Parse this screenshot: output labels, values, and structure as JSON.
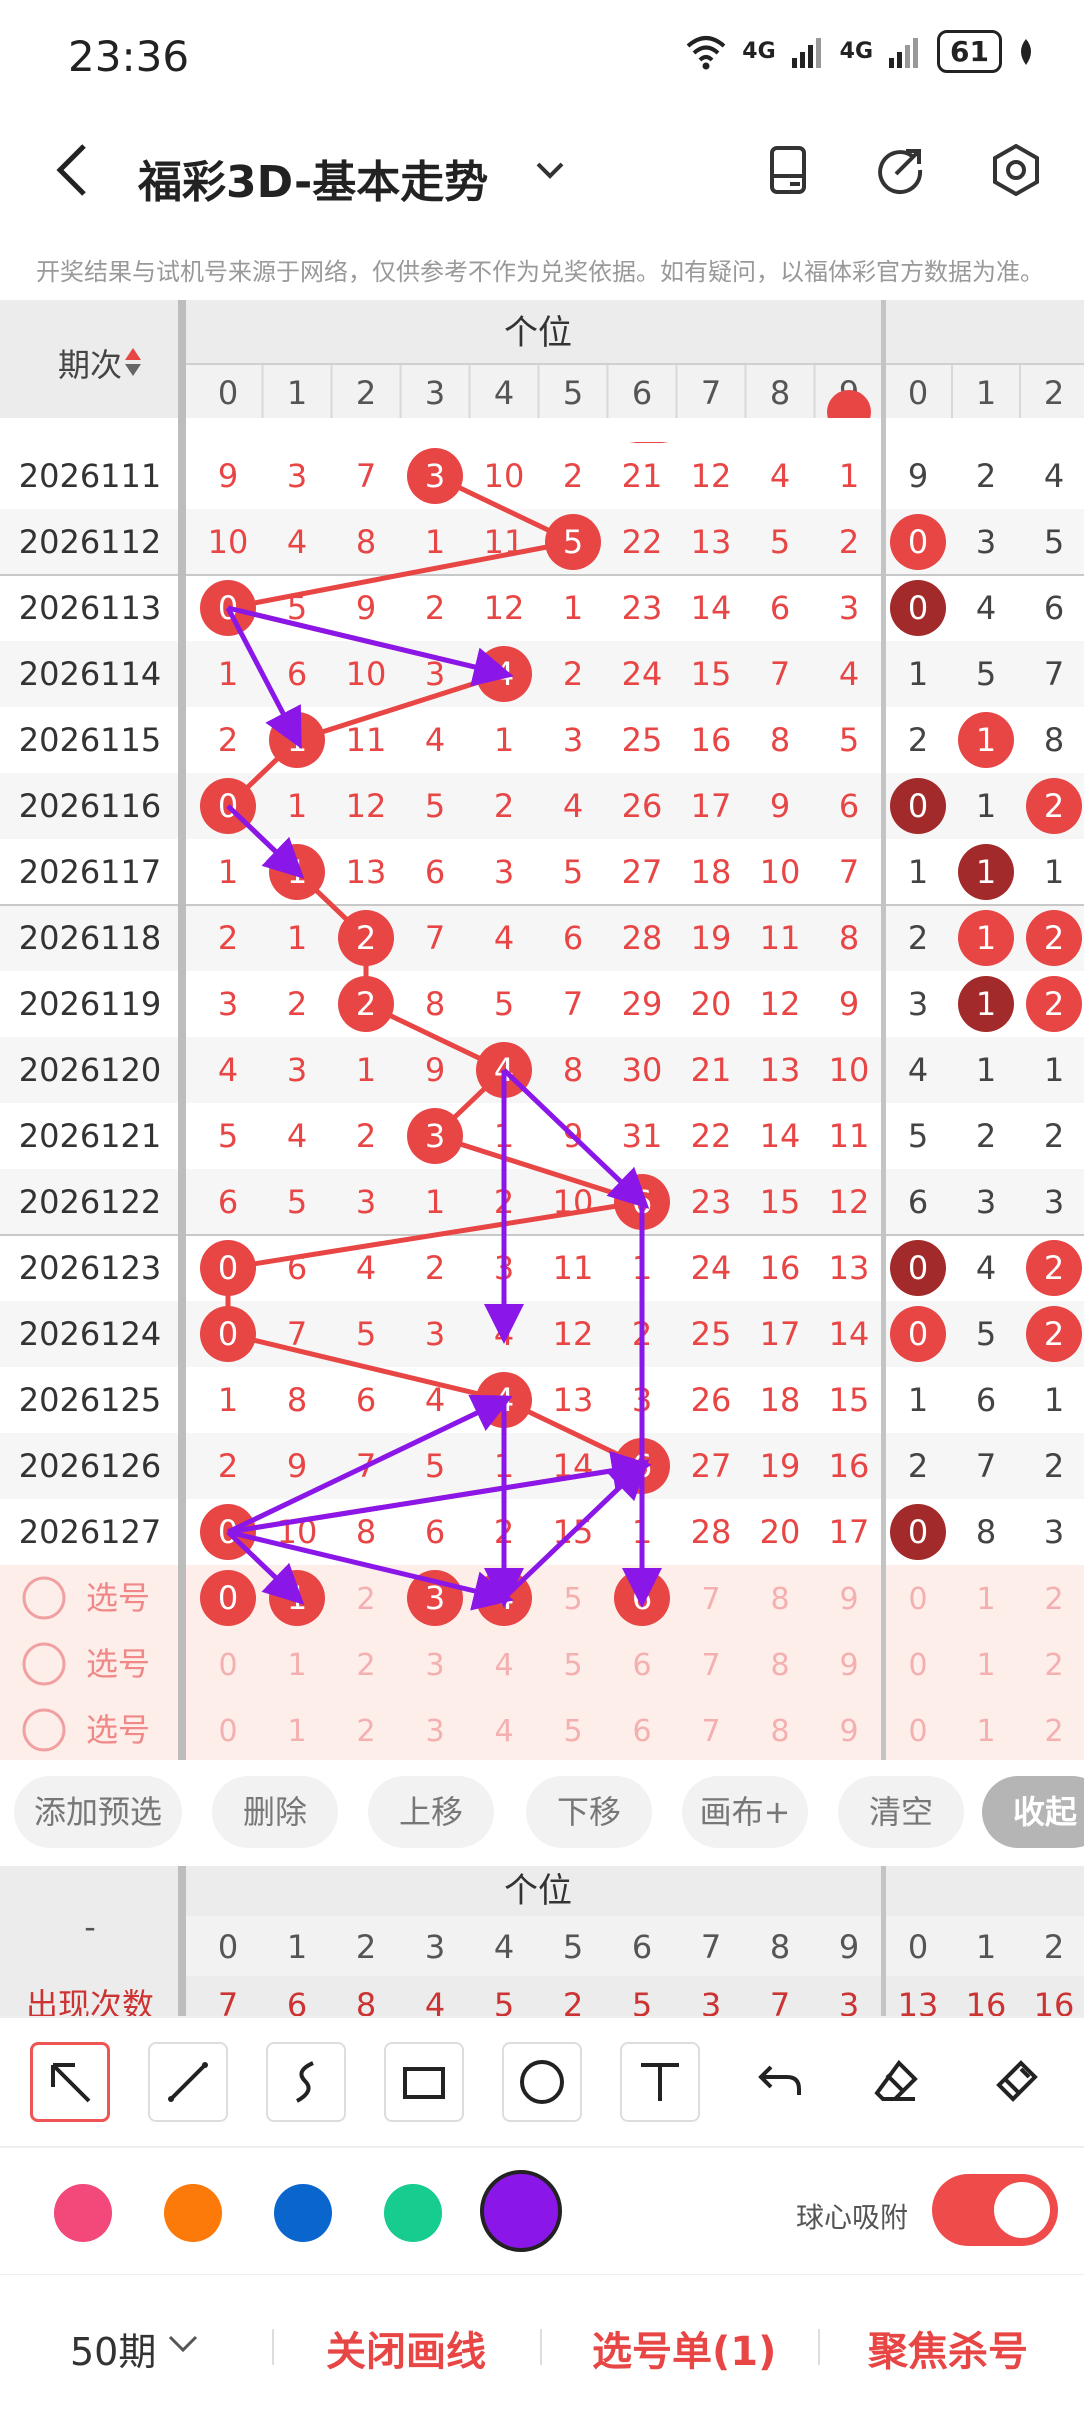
{
  "status": {
    "time": "23:36",
    "net1": "4G",
    "net2": "4G",
    "battery": "61"
  },
  "header": {
    "title": "福彩3D-基本走势"
  },
  "notice": "开奖结果与试机号来源于网络，仅供参考不作为兑奖依据。如有疑问，以福体彩官方数据为准。",
  "table": {
    "period_header": "期次",
    "group_label": "个位",
    "digits_main": [
      "0",
      "1",
      "2",
      "3",
      "4",
      "5",
      "6",
      "7",
      "8",
      "9"
    ],
    "digits_side": [
      "0",
      "1",
      "2"
    ],
    "rows": [
      {
        "period": "2026111",
        "main": [
          "9",
          "3",
          "7",
          "3",
          "10",
          "2",
          "21",
          "12",
          "4",
          "1"
        ],
        "hit": 3,
        "side": [
          "9",
          "2",
          "4"
        ],
        "side_hits": []
      },
      {
        "period": "2026112",
        "main": [
          "10",
          "4",
          "8",
          "1",
          "11",
          "5",
          "22",
          "13",
          "5",
          "2"
        ],
        "hit": 5,
        "side": [
          "0",
          "3",
          "5"
        ],
        "side_hits": [
          {
            "i": 0,
            "dark": false
          }
        ]
      },
      {
        "period": "2026113",
        "main": [
          "0",
          "5",
          "9",
          "2",
          "12",
          "1",
          "23",
          "14",
          "6",
          "3"
        ],
        "hit": 0,
        "side": [
          "0",
          "4",
          "6"
        ],
        "side_hits": [
          {
            "i": 0,
            "dark": true
          }
        ]
      },
      {
        "period": "2026114",
        "main": [
          "1",
          "6",
          "10",
          "3",
          "4",
          "2",
          "24",
          "15",
          "7",
          "4"
        ],
        "hit": 4,
        "side": [
          "1",
          "5",
          "7"
        ],
        "side_hits": []
      },
      {
        "period": "2026115",
        "main": [
          "2",
          "1",
          "11",
          "4",
          "1",
          "3",
          "25",
          "16",
          "8",
          "5"
        ],
        "hit": 1,
        "side": [
          "2",
          "1",
          "8"
        ],
        "side_hits": [
          {
            "i": 1,
            "dark": false
          }
        ]
      },
      {
        "period": "2026116",
        "main": [
          "0",
          "1",
          "12",
          "5",
          "2",
          "4",
          "26",
          "17",
          "9",
          "6"
        ],
        "hit": 0,
        "side": [
          "0",
          "1",
          "2"
        ],
        "side_hits": [
          {
            "i": 0,
            "dark": true
          },
          {
            "i": 2,
            "dark": false
          }
        ]
      },
      {
        "period": "2026117",
        "main": [
          "1",
          "1",
          "13",
          "6",
          "3",
          "5",
          "27",
          "18",
          "10",
          "7"
        ],
        "hit": 1,
        "side": [
          "1",
          "1",
          "1"
        ],
        "side_hits": [
          {
            "i": 1,
            "dark": true
          }
        ]
      },
      {
        "period": "2026118",
        "main": [
          "2",
          "1",
          "2",
          "7",
          "4",
          "6",
          "28",
          "19",
          "11",
          "8"
        ],
        "hit": 2,
        "side": [
          "2",
          "1",
          "2"
        ],
        "side_hits": [
          {
            "i": 1,
            "dark": false
          },
          {
            "i": 2,
            "dark": false
          }
        ]
      },
      {
        "period": "2026119",
        "main": [
          "3",
          "2",
          "2",
          "8",
          "5",
          "7",
          "29",
          "20",
          "12",
          "9"
        ],
        "hit": 2,
        "side": [
          "3",
          "1",
          "2"
        ],
        "side_hits": [
          {
            "i": 1,
            "dark": true
          },
          {
            "i": 2,
            "dark": false
          }
        ]
      },
      {
        "period": "2026120",
        "main": [
          "4",
          "3",
          "1",
          "9",
          "4",
          "8",
          "30",
          "21",
          "13",
          "10"
        ],
        "hit": 4,
        "side": [
          "4",
          "1",
          "1"
        ],
        "side_hits": []
      },
      {
        "period": "2026121",
        "main": [
          "5",
          "4",
          "2",
          "3",
          "1",
          "9",
          "31",
          "22",
          "14",
          "11"
        ],
        "hit": 3,
        "side": [
          "5",
          "2",
          "2"
        ],
        "side_hits": []
      },
      {
        "period": "2026122",
        "main": [
          "6",
          "5",
          "3",
          "1",
          "2",
          "10",
          "6",
          "23",
          "15",
          "12"
        ],
        "hit": 6,
        "side": [
          "6",
          "3",
          "3"
        ],
        "side_hits": []
      },
      {
        "period": "2026123",
        "main": [
          "0",
          "6",
          "4",
          "2",
          "3",
          "11",
          "1",
          "24",
          "16",
          "13"
        ],
        "hit": 0,
        "side": [
          "0",
          "4",
          "2"
        ],
        "side_hits": [
          {
            "i": 0,
            "dark": true
          },
          {
            "i": 2,
            "dark": false
          }
        ]
      },
      {
        "period": "2026124",
        "main": [
          "0",
          "7",
          "5",
          "3",
          "4",
          "12",
          "2",
          "25",
          "17",
          "14"
        ],
        "hit": 0,
        "side": [
          "0",
          "5",
          "2"
        ],
        "side_hits": [
          {
            "i": 0,
            "dark": false
          },
          {
            "i": 2,
            "dark": false
          }
        ]
      },
      {
        "period": "2026125",
        "main": [
          "1",
          "8",
          "6",
          "4",
          "4",
          "13",
          "3",
          "26",
          "18",
          "15"
        ],
        "hit": 4,
        "side": [
          "1",
          "6",
          "1"
        ],
        "side_hits": []
      },
      {
        "period": "2026126",
        "main": [
          "2",
          "9",
          "7",
          "5",
          "1",
          "14",
          "6",
          "27",
          "19",
          "16"
        ],
        "hit": 6,
        "side": [
          "2",
          "7",
          "2"
        ],
        "side_hits": []
      },
      {
        "period": "2026127",
        "main": [
          "0",
          "10",
          "8",
          "6",
          "2",
          "15",
          "1",
          "28",
          "20",
          "17"
        ],
        "hit": 0,
        "side": [
          "0",
          "8",
          "3"
        ],
        "side_hits": [
          {
            "i": 0,
            "dark": true
          }
        ]
      }
    ],
    "select_label": "选号",
    "select_rows": [
      {
        "hits": [
          0,
          1,
          3,
          4,
          6
        ]
      },
      {
        "hits": []
      },
      {
        "hits": []
      }
    ]
  },
  "buttons": [
    "添加预选",
    "删除",
    "上移",
    "下移",
    "画布+",
    "清空",
    "收起"
  ],
  "stats": {
    "dash": "-",
    "group_label": "个位",
    "row_label": "出现次数",
    "values_main": [
      "7",
      "6",
      "8",
      "4",
      "5",
      "2",
      "5",
      "3",
      "7",
      "3"
    ],
    "values_side": [
      "13",
      "16",
      "16"
    ]
  },
  "tools": [
    "select-arrow-icon",
    "line-icon",
    "curve-icon",
    "rectangle-icon",
    "circle-icon",
    "text-icon",
    "undo-icon",
    "eraser-icon",
    "clear-brush-icon"
  ],
  "colors": [
    "#f2487a",
    "#fb7a0a",
    "#0a66cc",
    "#16cc8e",
    "#8b16e8"
  ],
  "snap_label": "球心吸附",
  "bottom": {
    "period": "50期",
    "close_draw": "关闭画线",
    "selection": "选号单(1)",
    "focus": "聚焦杀号"
  }
}
